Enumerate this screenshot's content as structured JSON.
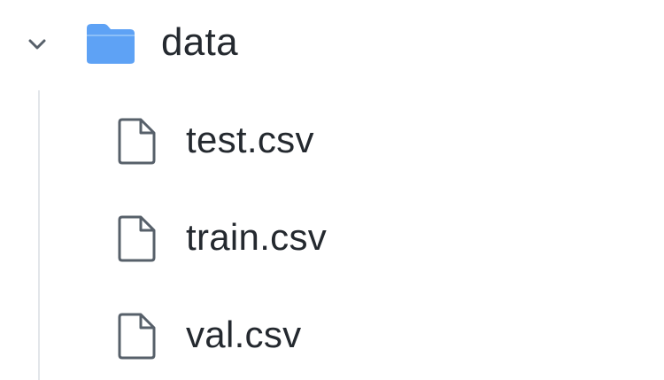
{
  "tree": {
    "folder": {
      "name": "data",
      "expanded": true,
      "toggle_icon": "chevron-down-icon",
      "icon": "folder-icon",
      "icon_color": "#5ea2f5"
    },
    "files": [
      {
        "name": "test.csv",
        "icon": "file-icon"
      },
      {
        "name": "train.csv",
        "icon": "file-icon"
      },
      {
        "name": "val.csv",
        "icon": "file-icon"
      }
    ]
  }
}
